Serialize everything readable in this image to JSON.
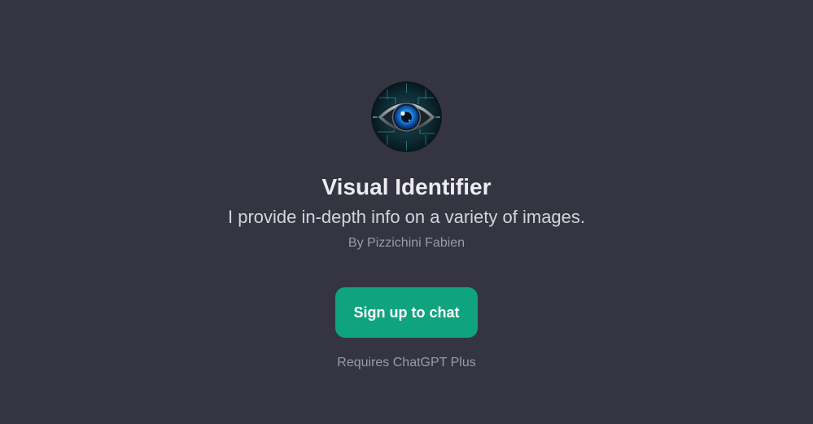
{
  "gpt": {
    "name": "Visual Identifier",
    "description": "I provide in-depth info on a variety of images.",
    "author": "By Pizzichini Fabien",
    "avatar_icon": "eye-icon"
  },
  "actions": {
    "signup_label": "Sign up to chat"
  },
  "footer": {
    "requirement": "Requires ChatGPT Plus"
  },
  "colors": {
    "background": "#343541",
    "accent": "#10a37f",
    "title": "#ececf1",
    "muted": "#9a9ba6"
  }
}
